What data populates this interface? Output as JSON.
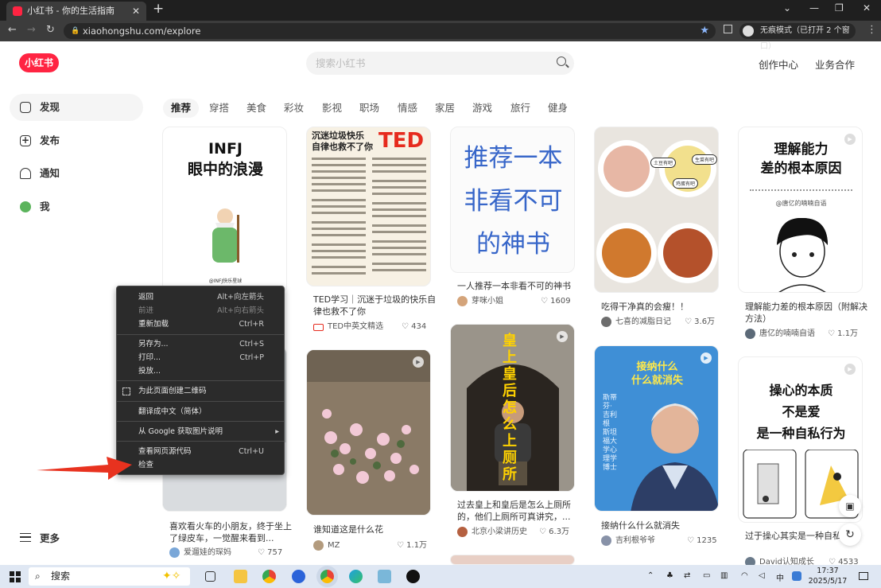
{
  "browser": {
    "tab_title": "小红书 - 你的生活指南",
    "tab_close": "✕",
    "new_tab": "+",
    "url": "xiaohongshu.com/explore",
    "profile": "无痕模式（已打开 2 个窗口）",
    "window_controls": [
      "⌄",
      "—",
      "❐",
      "✕"
    ]
  },
  "site": {
    "logo": "小红书",
    "search_placeholder": "搜索小红书",
    "header_links": [
      "创作中心",
      "业务合作"
    ]
  },
  "sidebar": {
    "items": [
      {
        "label": "发现",
        "icon": "home-icon",
        "active": true
      },
      {
        "label": "发布",
        "icon": "plus-icon"
      },
      {
        "label": "通知",
        "icon": "bell-icon"
      },
      {
        "label": "我",
        "icon": "avatar-icon"
      }
    ],
    "more": "更多"
  },
  "categories": [
    "推荐",
    "穿搭",
    "美食",
    "彩妆",
    "影视",
    "职场",
    "情感",
    "家居",
    "游戏",
    "旅行",
    "健身"
  ],
  "cards": [
    {
      "cover_text": "INFJ\n眼中的浪漫",
      "cover_caption": "@INFJ快乐星球",
      "title": "喜欢看火车的小朋友，终于坐上了绿皮车，一觉醒来看到...",
      "author": "爱遛娃的琛妈",
      "likes": "757"
    },
    {
      "cover_text": "沉迷垃圾快乐\n自律也救不了你",
      "cover_badge": "TED",
      "title": "TED学习｜沉迷于垃圾的快乐自律也救不了你",
      "author": "TED中英文精选",
      "likes": "434"
    },
    {
      "title": "谁知道这是什么花",
      "author": "MZ",
      "likes": "1.1万"
    },
    {
      "cover_text": "推荐一本\n非看不可\n的神书",
      "title": "一人推荐一本非看不可的神书",
      "author": "芽咪小姐",
      "likes": "1609"
    },
    {
      "cover_text": "皇上皇后怎么上厕所",
      "title": "过去皇上和皇后是怎么上厕所的，他们上厕所可真讲究，...",
      "author": "北京小梁讲历史",
      "likes": "6.3万"
    },
    {
      "cover_labels": [
        "土豆有吧",
        "生菜有吧",
        "鸡蛋有吧"
      ],
      "title": "吃得干净真的会瘦！！",
      "author": "七喜的减脂日记",
      "likes": "3.6万"
    },
    {
      "cover_text": "接纳什么\n什么就消失",
      "cover_side": "斯蒂芬·吉利根\n斯坦福大学心理学博士",
      "title": "接纳什么什么就消失",
      "author": "吉利根爷爷",
      "likes": "1235"
    },
    {
      "cover_text": "理解能力\n差的根本原因",
      "cover_caption": "@唐亿的喃喃自语",
      "title": "理解能力差的根本原因（附解决方法）",
      "author": "唐亿的喃喃自语",
      "likes": "1.1万"
    },
    {
      "cover_text": "操心的本质\n不是爱\n是一种自私行为",
      "title": "过于操心其实是一种自私行为",
      "author": "David认知成长",
      "likes": "4533"
    }
  ],
  "context_menu": [
    {
      "label": "返回",
      "shortcut": "Alt+向左箭头"
    },
    {
      "label": "前进",
      "shortcut": "Alt+向右箭头",
      "disabled": true
    },
    {
      "label": "重新加载",
      "shortcut": "Ctrl+R"
    },
    {
      "label": "另存为...",
      "shortcut": "Ctrl+S"
    },
    {
      "label": "打印...",
      "shortcut": "Ctrl+P"
    },
    {
      "label": "投放..."
    },
    {
      "label": "为此页面创建二维码"
    },
    {
      "label": "翻译成中文（简体）"
    },
    {
      "label": "从 Google 获取图片说明",
      "submenu": true
    },
    {
      "label": "查看网页源代码",
      "shortcut": "Ctrl+U"
    },
    {
      "label": "检查"
    }
  ],
  "taskbar": {
    "search": "搜索",
    "tray_lang": "中",
    "time": "17:37",
    "date": "2025/5/17"
  },
  "colors": {
    "brand": "#ff2442",
    "arrow": "#e8321f"
  }
}
